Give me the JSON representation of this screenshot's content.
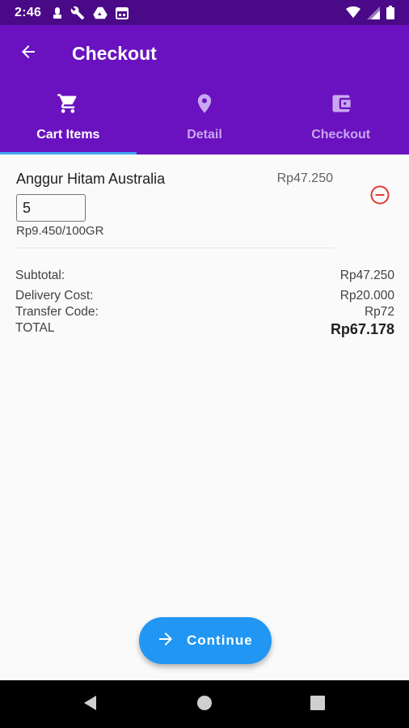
{
  "status_bar": {
    "time": "2:46",
    "left_icons": [
      "notification-icon",
      "wrench-icon",
      "drive-icon",
      "calendar-icon"
    ],
    "right_icons": [
      "wifi-icon",
      "signal-icon",
      "battery-icon"
    ]
  },
  "app_bar": {
    "back_icon": "arrow-back-icon",
    "title": "Checkout",
    "background": "#6a12bf"
  },
  "tabs": [
    {
      "label": "Cart Items",
      "icon": "cart-icon",
      "active": true
    },
    {
      "label": "Detail",
      "icon": "location-pin-icon",
      "active": false
    },
    {
      "label": "Checkout",
      "icon": "wallet-icon",
      "active": false
    }
  ],
  "cart": {
    "items": [
      {
        "name": "Anggur Hitam Australia",
        "price": "Rp47.250",
        "quantity": "5",
        "unit_price": "Rp9.450/100GR",
        "remove_icon": "remove-circle-icon"
      }
    ]
  },
  "summary": {
    "subtotal_label": "Subtotal:",
    "subtotal_value": "Rp47.250",
    "delivery_label": "Delivery Cost:",
    "delivery_value": "Rp20.000",
    "transfer_label": "Transfer Code:",
    "transfer_value": "Rp72",
    "total_label": "TOTAL",
    "total_value": "Rp67.178"
  },
  "continue_button": {
    "label": "Continue",
    "icon": "arrow-forward-icon",
    "color": "#2196f3"
  },
  "nav_bar": {
    "buttons": [
      "back-triangle-icon",
      "home-circle-icon",
      "recents-square-icon"
    ]
  },
  "colors": {
    "status_bar": "#4a0a87",
    "accent_indicator": "#42a5f5",
    "remove": "#e53935"
  }
}
